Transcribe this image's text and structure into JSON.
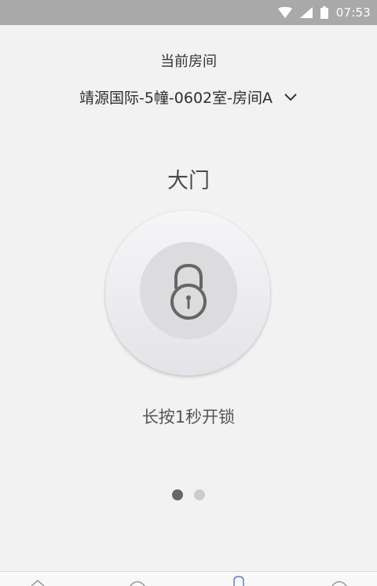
{
  "status_bar": {
    "time": "07:53",
    "icons": [
      "wifi-icon",
      "signal-icon",
      "battery-icon"
    ]
  },
  "room": {
    "label": "当前房间",
    "selected": "靖源国际-5幢-0602室-房间A"
  },
  "door": {
    "name": "大门",
    "hint": "长按1秒开锁"
  },
  "pager": {
    "current": 1,
    "total": 2
  },
  "colors": {
    "background": "#f2f2f2",
    "status_bar": "#a9a9a9",
    "lock_icon": "#666666"
  },
  "bottom_nav": {
    "icons": [
      "home-icon",
      "circle-icon",
      "user-icon",
      "more-icon"
    ]
  }
}
